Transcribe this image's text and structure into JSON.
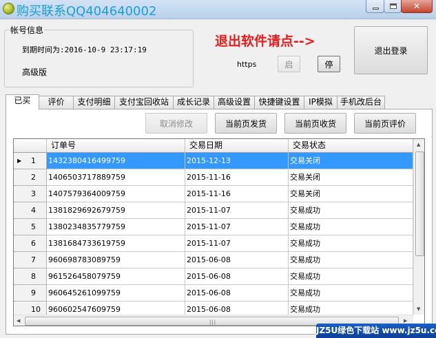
{
  "window": {
    "title": "购买联系QQ404640002"
  },
  "account": {
    "group_label": "帐号信息",
    "expire": "到期时间为:2016-10-9 23:17:19",
    "edition": "高级版"
  },
  "exit_hint": "退出软件请点-->",
  "https_label": "https",
  "buttons": {
    "start": "启",
    "stop": "停",
    "logout": "退出登录",
    "cancel_edit": "取消修改",
    "ship_page": "当前页发货",
    "receive_page": "当前页收货",
    "review_page": "当前页评价"
  },
  "tabs": [
    "已买",
    "评价",
    "支付明细",
    "支付宝回收站",
    "成长记录",
    "高级设置",
    "快捷键设置",
    "IP模拟",
    "手机改后台"
  ],
  "table": {
    "columns": [
      "订单号",
      "交易日期",
      "交易状态"
    ],
    "rows": [
      {
        "num": "1",
        "order": "1432380416499759",
        "date": "2015-12-13",
        "status": "交易关闭"
      },
      {
        "num": "2",
        "order": "1406503717889759",
        "date": "2015-11-16",
        "status": "交易关闭"
      },
      {
        "num": "3",
        "order": "1407579364009759",
        "date": "2015-11-16",
        "status": "交易关闭"
      },
      {
        "num": "4",
        "order": "1381829692679759",
        "date": "2015-11-07",
        "status": "交易成功"
      },
      {
        "num": "5",
        "order": "1380234835779759",
        "date": "2015-11-07",
        "status": "交易成功"
      },
      {
        "num": "6",
        "order": "1381684733619759",
        "date": "2015-11-07",
        "status": "交易成功"
      },
      {
        "num": "7",
        "order": "960698783089759",
        "date": "2015-06-08",
        "status": "交易成功"
      },
      {
        "num": "8",
        "order": "961526458079759",
        "date": "2015-06-08",
        "status": "交易成功"
      },
      {
        "num": "9",
        "order": "960645261099759",
        "date": "2015-06-08",
        "status": "交易成功"
      },
      {
        "num": "10",
        "order": "960602547609759",
        "date": "2015-06-08",
        "status": "交易成功"
      }
    ]
  },
  "watermark": "JZ5U绿色下载站 www.jz5u.com",
  "colors": {
    "accent_title": "#1a9fd6",
    "exit_hint": "#e81c1c",
    "selection": "#3399ff"
  }
}
